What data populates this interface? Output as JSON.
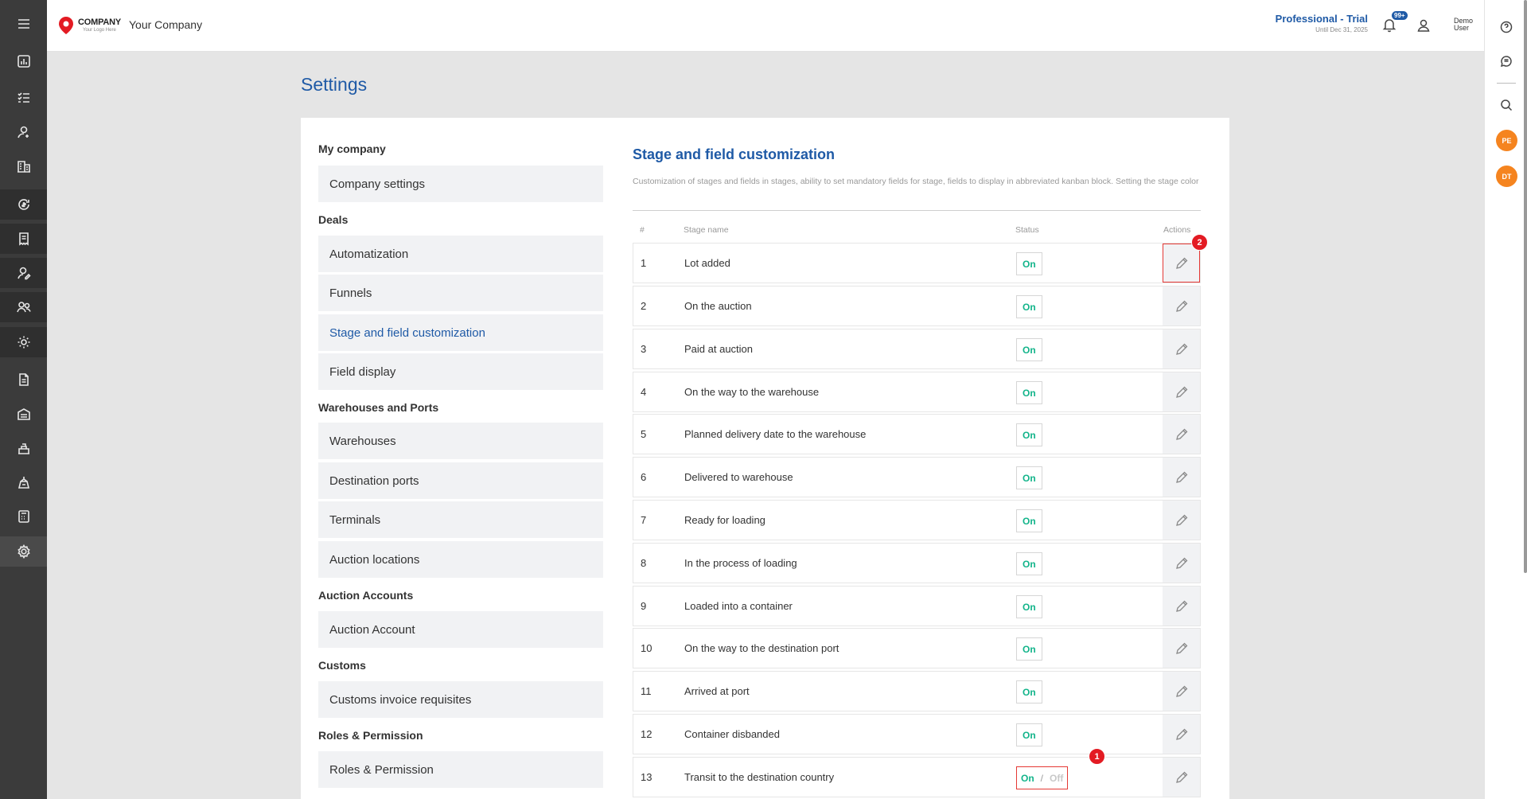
{
  "header": {
    "logo_brand": "COMPANY",
    "logo_tagline": "Your Logo Here",
    "company_name": "Your Company",
    "plan_name": "Professional - Trial",
    "plan_until": "Until Dec 31, 2025",
    "notification_count": "99+",
    "user_first": "Demo",
    "user_last": "User"
  },
  "left_nav": {
    "icons": [
      "menu-icon",
      "dashboard-chart-icon",
      "task-list-icon",
      "user-add-icon",
      "buildings-icon",
      "refresh-money-icon",
      "receipt-icon",
      "user-edit-icon",
      "users-group-icon",
      "gear-user-icon",
      "document-icon",
      "warehouse-icon",
      "cargo-icon",
      "port-icon",
      "calculator-icon",
      "settings-icon"
    ]
  },
  "right_bar": {
    "icons": [
      "help-icon",
      "chat-icon",
      "search-icon"
    ],
    "avatars": [
      "PE",
      "DT"
    ]
  },
  "page": {
    "title": "Settings"
  },
  "menu": {
    "sections": [
      {
        "title": "My company",
        "items": [
          "Company settings"
        ]
      },
      {
        "title": "Deals",
        "items": [
          "Automatization",
          "Funnels",
          "Stage and field customization",
          "Field display"
        ]
      },
      {
        "title": "Warehouses and Ports",
        "items": [
          "Warehouses",
          "Destination ports",
          "Terminals",
          "Auction locations"
        ]
      },
      {
        "title": "Auction Accounts",
        "items": [
          "Auction Account"
        ]
      },
      {
        "title": "Customs",
        "items": [
          "Customs invoice requisites"
        ]
      },
      {
        "title": "Roles & Permission",
        "items": [
          "Roles & Permission"
        ]
      }
    ],
    "active_item": "Stage and field customization"
  },
  "content": {
    "title": "Stage and field customization",
    "description": "Customization of stages and fields in stages, ability to set mandatory fields for stage, fields to display in abbreviated kanban block. Setting the stage color",
    "columns": {
      "num": "#",
      "name": "Stage name",
      "status": "Status",
      "actions": "Actions"
    },
    "status_on": "On",
    "status_off": "Off",
    "status_separator": "/",
    "rows": [
      {
        "num": "1",
        "name": "Lot added",
        "status": "On"
      },
      {
        "num": "2",
        "name": "On the auction",
        "status": "On"
      },
      {
        "num": "3",
        "name": "Paid at auction",
        "status": "On"
      },
      {
        "num": "4",
        "name": "On the way to the warehouse",
        "status": "On"
      },
      {
        "num": "5",
        "name": "Planned delivery date to the warehouse",
        "status": "On"
      },
      {
        "num": "6",
        "name": "Delivered to warehouse",
        "status": "On"
      },
      {
        "num": "7",
        "name": "Ready for loading",
        "status": "On"
      },
      {
        "num": "8",
        "name": "In the process of loading",
        "status": "On"
      },
      {
        "num": "9",
        "name": "Loaded into a container",
        "status": "On"
      },
      {
        "num": "10",
        "name": "On the way to the destination port",
        "status": "On"
      },
      {
        "num": "11",
        "name": "Arrived at port",
        "status": "On"
      },
      {
        "num": "12",
        "name": "Container disbanded",
        "status": "On"
      },
      {
        "num": "13",
        "name": "Transit to the destination country",
        "status": "On / Off"
      }
    ],
    "markers": {
      "toggle": "1",
      "edit": "2"
    }
  },
  "colors": {
    "accent": "#1f5aa6",
    "on_green": "#12b48a",
    "highlight_red": "#e53935",
    "sidebar_bg": "#3b3b3b",
    "avatar_orange": "#f5841f"
  }
}
